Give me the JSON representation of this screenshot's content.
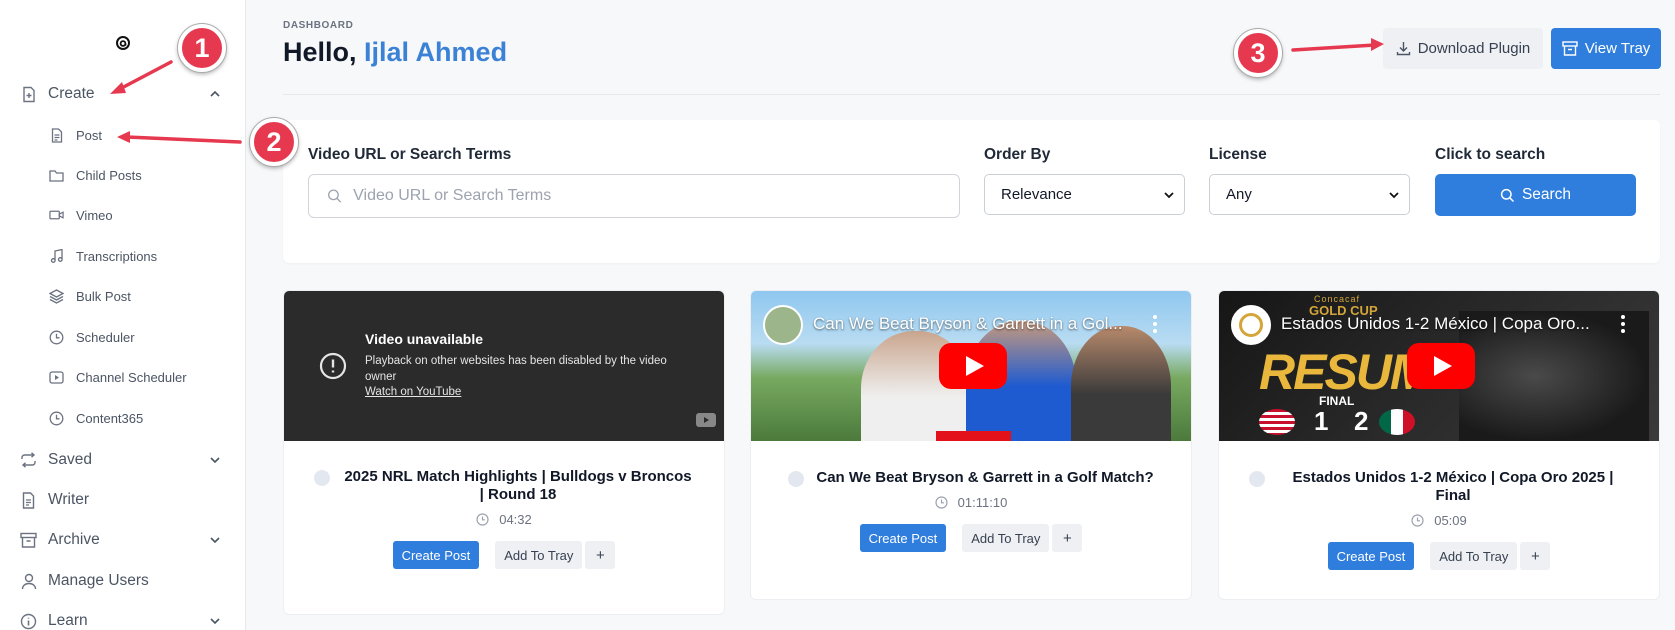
{
  "sidebar": {
    "items": [
      {
        "label": "Create",
        "icon": "file-plus-icon",
        "expanded": true
      },
      {
        "label": "Post",
        "icon": "file-text-icon"
      },
      {
        "label": "Child Posts",
        "icon": "folder-icon"
      },
      {
        "label": "Vimeo",
        "icon": "video-icon"
      },
      {
        "label": "Transcriptions",
        "icon": "music-note-icon"
      },
      {
        "label": "Bulk Post",
        "icon": "layers-icon"
      },
      {
        "label": "Scheduler",
        "icon": "clock-icon"
      },
      {
        "label": "Channel Scheduler",
        "icon": "play-square-icon"
      },
      {
        "label": "Content365",
        "icon": "clock-icon"
      },
      {
        "label": "Saved",
        "icon": "repeat-icon",
        "expanded": false
      },
      {
        "label": "Writer",
        "icon": "file-text-icon"
      },
      {
        "label": "Archive",
        "icon": "archive-icon",
        "expanded": false
      },
      {
        "label": "Manage Users",
        "icon": "user-icon"
      },
      {
        "label": "Learn",
        "icon": "info-icon",
        "expanded": false
      }
    ]
  },
  "header": {
    "section": "DASHBOARD",
    "greeting": "Hello,",
    "user_name": "Ijlal Ahmed",
    "download_plugin": "Download Plugin",
    "view_tray": "View Tray"
  },
  "search": {
    "query_label": "Video URL or Search Terms",
    "query_placeholder": "Video URL or Search Terms",
    "order_label": "Order By",
    "order_value": "Relevance",
    "license_label": "License",
    "license_value": "Any",
    "click_label": "Click to search",
    "button": "Search"
  },
  "videos": [
    {
      "title": "2025 NRL Match Highlights | Bulldogs v Broncos | Round 18",
      "duration": "04:32",
      "unavailable_title": "Video unavailable",
      "unavailable_msg": "Playback on other websites has been disabled by the video owner",
      "unavailable_link": "Watch on YouTube"
    },
    {
      "title": "Can We Beat Bryson & Garrett in a Golf Match?",
      "duration": "01:11:10",
      "overlay_title": "Can We Beat Bryson & Garrett in a Gol..."
    },
    {
      "title": "Estados Unidos 1-2 México | Copa Oro 2025 | Final",
      "duration": "05:09",
      "overlay_title": "Estados Unidos 1-2 México | Copa Oro...",
      "thumb_text": {
        "resumen": "RESUMEN",
        "final": "FINAL",
        "score_home": "1",
        "score_away": "2",
        "cup_small": "Concacaf",
        "cup_big": "GOLD CUP"
      }
    }
  ],
  "card_actions": {
    "create": "Create Post",
    "add": "Add To Tray",
    "plus": "+"
  },
  "annotations": [
    "1",
    "2",
    "3"
  ],
  "colors": {
    "accent": "#2f7ddc",
    "name": "#3b82d6",
    "badge": "#e63950"
  }
}
